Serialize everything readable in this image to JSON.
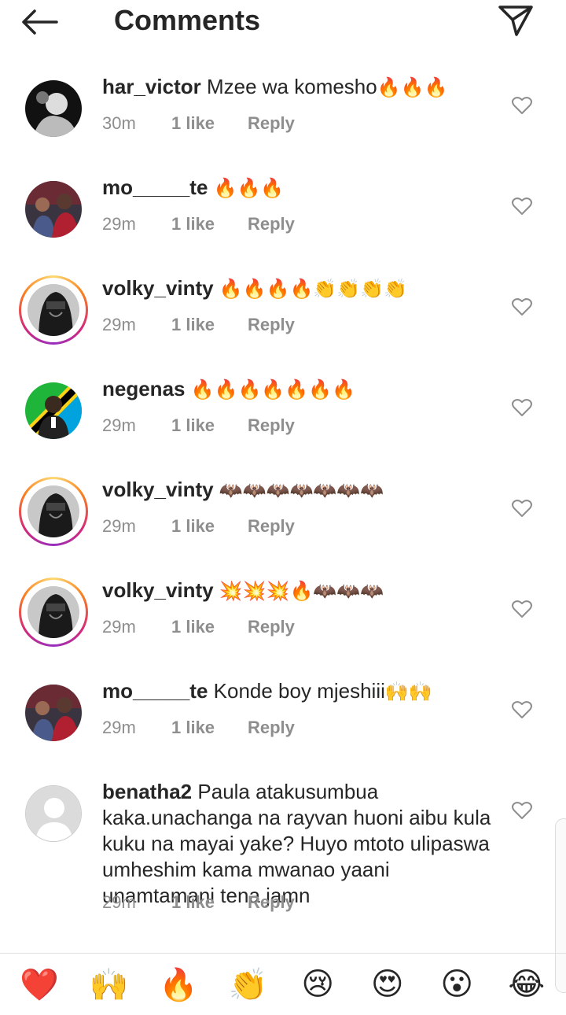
{
  "header": {
    "title": "Comments"
  },
  "comments": [
    {
      "username": "har_victor",
      "text": "Mzee wa komesho",
      "emojis": "🔥🔥🔥",
      "time": "30m",
      "likes": "1 like",
      "reply": "Reply",
      "avatar": "bw"
    },
    {
      "username": "mo_____te",
      "text": "",
      "emojis": "🔥🔥🔥",
      "time": "29m",
      "likes": "1 like",
      "reply": "Reply",
      "avatar": "red"
    },
    {
      "username": "volky_vinty",
      "text": "",
      "emojis": "🔥🔥🔥🔥👏👏👏👏",
      "time": "29m",
      "likes": "1 like",
      "reply": "Reply",
      "avatar": "ring"
    },
    {
      "username": "negenas",
      "text": "",
      "emojis": "🔥🔥🔥🔥🔥🔥🔥",
      "time": "29m",
      "likes": "1 like",
      "reply": "Reply",
      "avatar": "flag"
    },
    {
      "username": "volky_vinty",
      "text": "",
      "emojis": "🦇🦇🦇🦇🦇🦇🦇",
      "time": "29m",
      "likes": "1 like",
      "reply": "Reply",
      "avatar": "ring"
    },
    {
      "username": "volky_vinty",
      "text": "",
      "emojis": "💥💥💥🔥🦇🦇🦇",
      "time": "29m",
      "likes": "1 like",
      "reply": "Reply",
      "avatar": "ring"
    },
    {
      "username": "mo_____te",
      "text": "Konde boy mjeshiii",
      "emojis": "🙌🙌",
      "time": "29m",
      "likes": "1 like",
      "reply": "Reply",
      "avatar": "red"
    },
    {
      "username": "benatha2",
      "text": "Paula atakusumbua kaka.unachanga na rayvan huoni aibu kula kuku na mayai yake? Huyo mtoto ulipaswa umheshim kama mwanao yaani unamtamani tena jamn",
      "emojis": "",
      "time": "29m",
      "likes": "1 like",
      "reply": "Reply",
      "avatar": "default"
    }
  ],
  "quick_reactions": [
    "❤️",
    "🙌",
    "🔥",
    "👏",
    "😢",
    "😍",
    "😮",
    "😂"
  ],
  "icons": {
    "back": "arrow-left-icon",
    "send": "paper-plane-icon",
    "like": "heart-outline-icon"
  },
  "colors": {
    "text": "#262626",
    "meta": "#8e8e8e",
    "story_ring_start": "#feda75",
    "story_ring_end": "#d62976"
  }
}
